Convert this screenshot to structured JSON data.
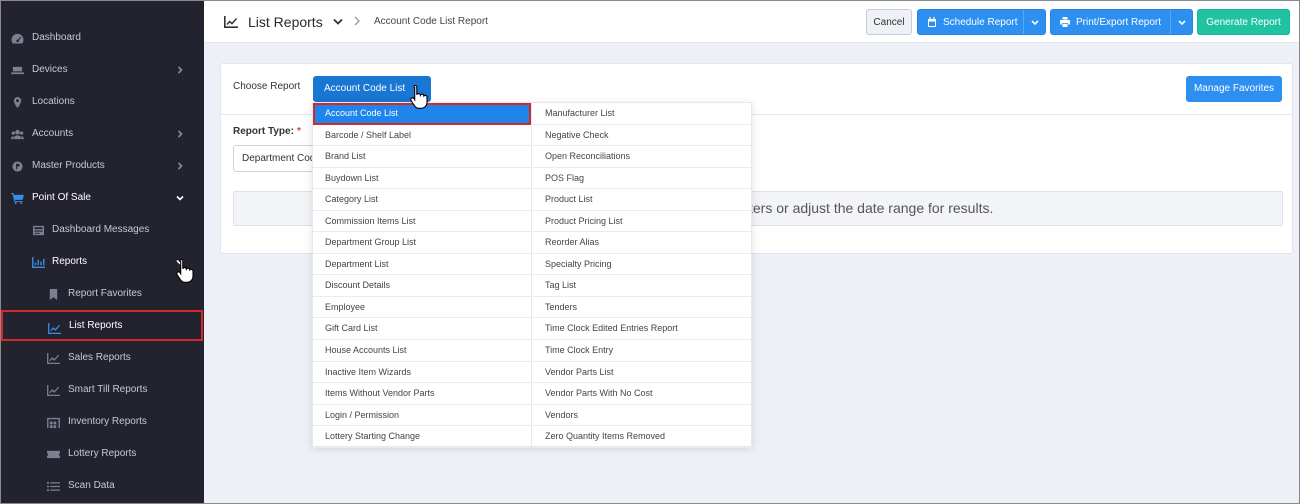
{
  "sidebar": {
    "items": [
      {
        "label": "Dashboard",
        "icon": "dashboard-icon"
      },
      {
        "label": "Devices",
        "icon": "devices-icon"
      },
      {
        "label": "Locations",
        "icon": "location-pin-icon"
      },
      {
        "label": "Accounts",
        "icon": "users-icon"
      },
      {
        "label": "Master Products",
        "icon": "product-icon"
      },
      {
        "label": "Point Of Sale",
        "icon": "cart-icon"
      },
      {
        "label": "Dashboard Messages",
        "icon": "message-icon"
      },
      {
        "label": "Reports",
        "icon": "chart-icon"
      },
      {
        "label": "Report Favorites",
        "icon": "bookmark-icon"
      },
      {
        "label": "List Reports",
        "icon": "chart-line-icon"
      },
      {
        "label": "Sales Reports",
        "icon": "chart-line-icon"
      },
      {
        "label": "Smart Till Reports",
        "icon": "chart-line-icon"
      },
      {
        "label": "Inventory Reports",
        "icon": "warehouse-icon"
      },
      {
        "label": "Lottery Reports",
        "icon": "ticket-icon"
      },
      {
        "label": "Scan Data",
        "icon": "list-icon"
      }
    ]
  },
  "topbar": {
    "title": "List Reports",
    "breadcrumb": "Account Code List Report",
    "cancel_label": "Cancel",
    "schedule_label": "Schedule Report",
    "print_label": "Print/Export Report",
    "generate_label": "Generate Report"
  },
  "card": {
    "choose_label": "Choose Report",
    "choose_value": "Account Code List",
    "favorites_label": "Manage Favorites",
    "report_type_label": "Report Type:",
    "required_mark": "*",
    "report_type_value": "Department Code",
    "notice_text": "ters or adjust the date range for results."
  },
  "menu": {
    "col1": [
      "Account Code List",
      "Barcode / Shelf Label",
      "Brand List",
      "Buydown List",
      "Category List",
      "Commission Items List",
      "Department Group List",
      "Department List",
      "Discount Details",
      "Employee",
      "Gift Card List",
      "House Accounts List",
      "Inactive Item Wizards",
      "Items Without Vendor Parts",
      "Login / Permission",
      "Lottery Starting Change"
    ],
    "col2": [
      "Manufacturer List",
      "Negative Check",
      "Open Reconciliations",
      "POS Flag",
      "Product List",
      "Product Pricing List",
      "Reorder Alias",
      "Specialty Pricing",
      "Tag List",
      "Tenders",
      "Time Clock Edited Entries Report",
      "Time Clock Entry",
      "Vendor Parts List",
      "Vendor Parts With No Cost",
      "Vendors",
      "Zero Quantity Items Removed"
    ]
  },
  "colors": {
    "sidebar_bg": "#23232f",
    "accent_blue": "#2d8ff0",
    "generate_green": "#1fc3a2",
    "highlight_red": "#d12a2a"
  }
}
